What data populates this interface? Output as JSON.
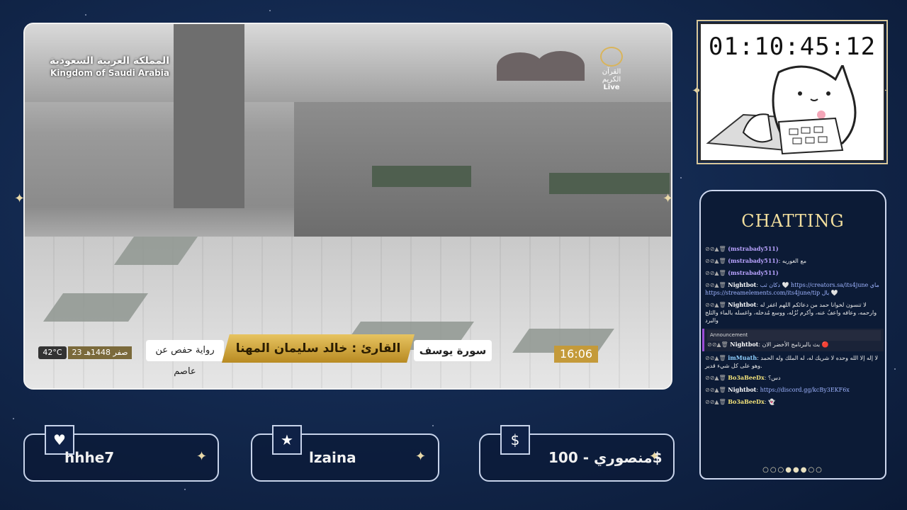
{
  "stream": {
    "overlay_country_ar": "المملكة العربية السعودية",
    "overlay_country_en": "Kingdom of Saudi Arabia",
    "channel_name": "القرآن الكريم",
    "live_label": "Live",
    "temperature": "42°C",
    "hijri_date": "23 صفر 1448هـ",
    "riwaya": "رواية حفص عن عاصم",
    "reciter": "القارئ : خالد سليمان المهنا",
    "surah": "سورة يوسف",
    "clock": "16:06"
  },
  "timer": {
    "value": "01:10:45:12"
  },
  "chat": {
    "title": "CHATTING",
    "messages": [
      {
        "user": "(mstrabady511)",
        "text": ""
      },
      {
        "user": "(mstrabady511)",
        "text": "مع الغوريه"
      },
      {
        "user": "(mstrabady511)",
        "text": ""
      },
      {
        "user": "Nightbot",
        "text": "دكان ثب 🤍 https://creators.sa/its4june ماي https://streamelements.com/its4june/tip بال 🤍"
      },
      {
        "user": "Nightbot",
        "text": "لا تنسون لخوانا حمد من دعائكم اللهم اغفر له وارحمه، وعافه واعفُ عنه، وأكرم نُزُله، ووسع مُدخله، واغسله بالماء والثلج والبرد"
      },
      {
        "user": "Nightbot",
        "text": "بث بالبرنامج الأخضر الان 🔴",
        "announcement": "Announcement"
      },
      {
        "user": "imMuath",
        "text": "لا إله إلا الله وحده لا شريك له، له الملك وله الحمد وهو على كل شيء قدير."
      },
      {
        "user": "Bo3aBeeDx",
        "text": "دس؟"
      },
      {
        "user": "Nightbot",
        "text": "https://discord.gg/kcBy3EKF6x"
      },
      {
        "user": "Bo3aBeeDx",
        "text": "👻"
      }
    ],
    "dots": "○○○●●●○○"
  },
  "cards": {
    "follower": {
      "icon": "heart-icon",
      "value": "hhhe7"
    },
    "subscriber": {
      "icon": "star-icon",
      "value": "lzaina"
    },
    "donation": {
      "icon": "dollar-icon",
      "value": "منصوري - 100$"
    }
  }
}
